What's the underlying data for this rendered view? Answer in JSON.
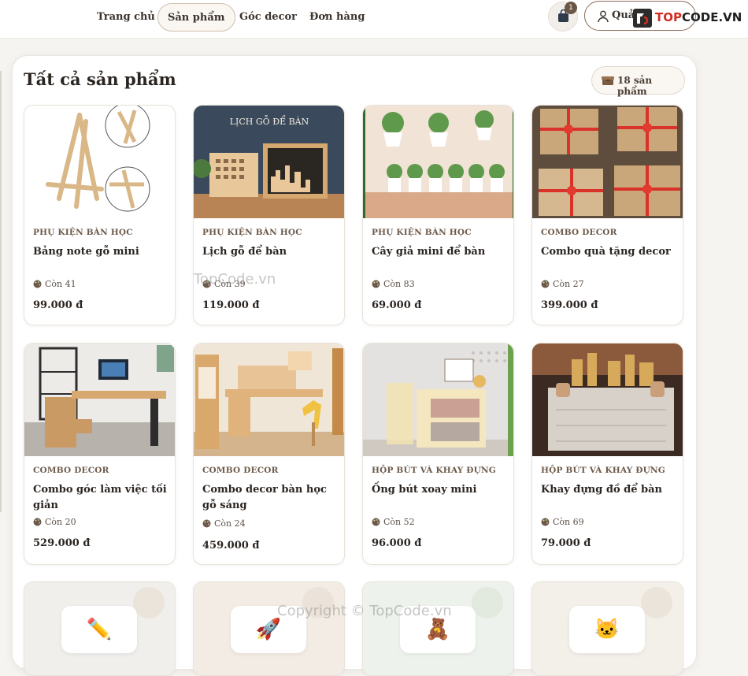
{
  "nav": {
    "items": [
      {
        "label": "Trang chủ"
      },
      {
        "label": "Sản phẩm"
      },
      {
        "label": "Góc decor"
      },
      {
        "label": "Đơn hàng"
      }
    ]
  },
  "cart": {
    "count": "1",
    "icon": "shopping-bag-icon"
  },
  "account": {
    "label": "Quả",
    "icon": "user-icon"
  },
  "logo": {
    "text_a": "TOP",
    "text_b": "CODE.VN",
    "brand_color": "#d22d22"
  },
  "page": {
    "title": "Tất cả sản phẩm",
    "count_label": "18 sản phẩm"
  },
  "products": [
    {
      "category": "PHỤ KIỆN BÀN HỌC",
      "name": "Bảng note gỗ mini",
      "stock": "Còn 41",
      "price": "99.000 đ"
    },
    {
      "category": "PHỤ KIỆN BÀN HỌC",
      "name": "Lịch gỗ để bàn",
      "stock": "Còn 39",
      "price": "119.000 đ",
      "image_text": "LỊCH GỖ ĐỂ BÀN"
    },
    {
      "category": "PHỤ KIỆN BÀN HỌC",
      "name": "Cây giả mini để bàn",
      "stock": "Còn 83",
      "price": "69.000 đ"
    },
    {
      "category": "COMBO DECOR",
      "name": "Combo quà tặng decor",
      "stock": "Còn 27",
      "price": "399.000 đ"
    },
    {
      "category": "COMBO DECOR",
      "name": "Combo góc làm việc tối giản",
      "stock": "Còn 20",
      "price": "529.000 đ"
    },
    {
      "category": "COMBO DECOR",
      "name": "Combo decor bàn học gỗ sáng",
      "stock": "Còn 24",
      "price": "459.000 đ"
    },
    {
      "category": "HỘP BÚT VÀ KHAY ĐỰNG",
      "name": "Ống bút xoay mini",
      "stock": "Còn 52",
      "price": "96.000 đ"
    },
    {
      "category": "HỘP BÚT VÀ KHAY ĐỰNG",
      "name": "Khay đựng đồ để bàn",
      "stock": "Còn 69",
      "price": "79.000 đ"
    }
  ],
  "partial_row": [
    {
      "emoji": "✏️"
    },
    {
      "emoji": "🚀"
    },
    {
      "emoji": "🧸"
    },
    {
      "emoji": "🐱"
    }
  ],
  "watermarks": {
    "mid": "TopCode.vn",
    "bottom": "Copyright © TopCode.vn"
  }
}
